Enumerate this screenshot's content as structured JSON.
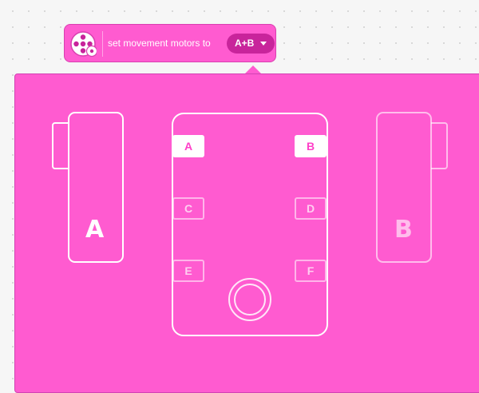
{
  "block": {
    "label": "set movement motors to",
    "icon": "movement-motors-icon",
    "selected_ports": "A+B",
    "dropdown_icon": "chevron-down-icon"
  },
  "popup": {
    "left_motor": {
      "label": "A",
      "active": true
    },
    "right_motor": {
      "label": "B",
      "active": false
    },
    "hub": {
      "ports": [
        {
          "label": "A",
          "selected": true
        },
        {
          "label": "B",
          "selected": true
        },
        {
          "label": "C",
          "selected": false
        },
        {
          "label": "D",
          "selected": false
        },
        {
          "label": "E",
          "selected": false
        },
        {
          "label": "F",
          "selected": false
        }
      ],
      "center_button_icon": "hub-center-button-icon"
    }
  },
  "colors": {
    "accent": "#ff5bd0",
    "accent_dark": "#c8249b",
    "canvas": "#f6f6f6",
    "outline": "#ffffff"
  }
}
